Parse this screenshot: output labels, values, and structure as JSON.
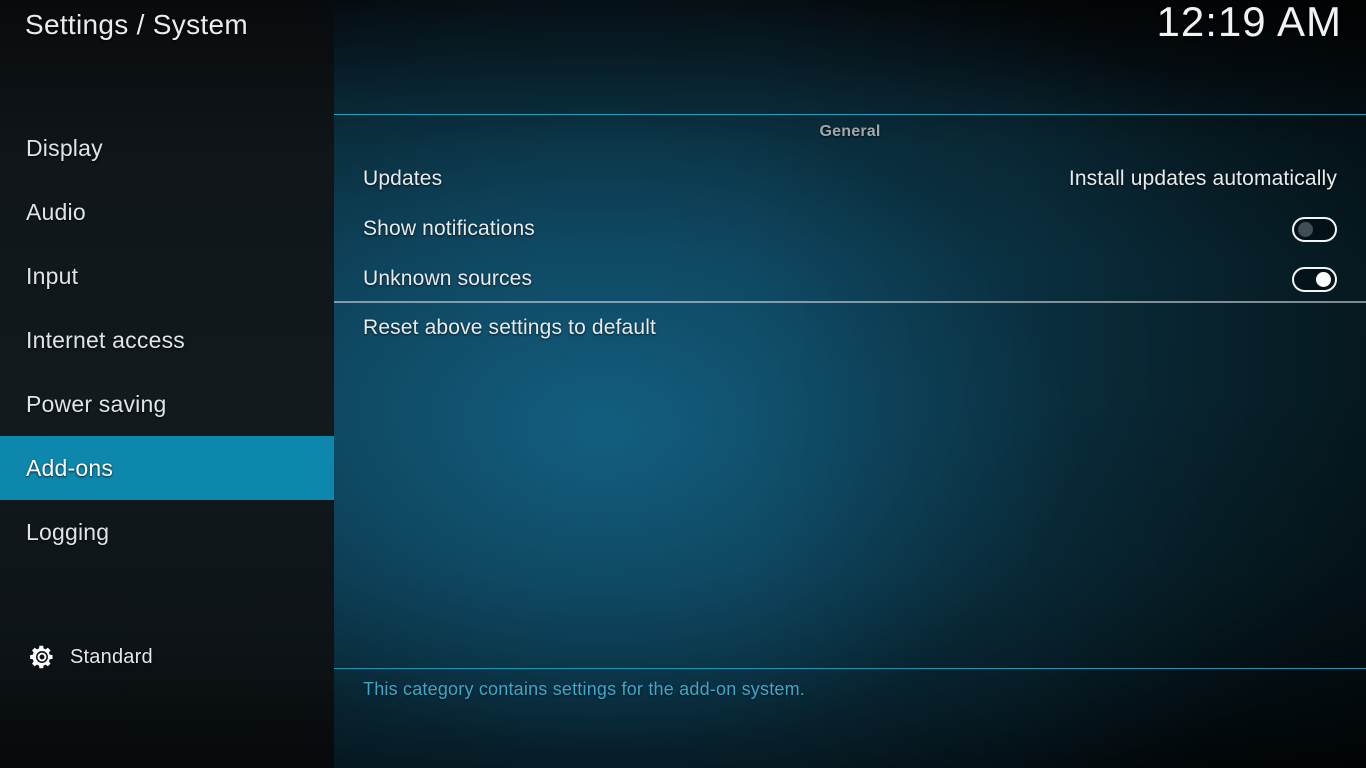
{
  "window": {
    "title": "Settings / System",
    "clock": "12:19 AM"
  },
  "theme": {
    "accent": "#0e87ad",
    "rule_teal": "#1fb6d6",
    "description_color": "#3ea8c8",
    "sidebar_bg": "#10161a",
    "text_primary": "#e7ebec",
    "group_header_color": "#9fa9ad"
  },
  "sidebar": {
    "items": [
      {
        "label": "Display",
        "selected": false,
        "icon": "category-icon"
      },
      {
        "label": "Audio",
        "selected": false,
        "icon": "category-icon"
      },
      {
        "label": "Input",
        "selected": false,
        "icon": "category-icon"
      },
      {
        "label": "Internet access",
        "selected": false,
        "icon": "category-icon"
      },
      {
        "label": "Power saving",
        "selected": false,
        "icon": "category-icon"
      },
      {
        "label": "Add-ons",
        "selected": true,
        "icon": "category-icon"
      },
      {
        "label": "Logging",
        "selected": false,
        "icon": "category-icon"
      }
    ],
    "profile": {
      "icon": "gear-icon",
      "label": "Standard"
    }
  },
  "content": {
    "group_header": "General",
    "settings": [
      {
        "label": "Updates",
        "type": "value",
        "value": "Install updates automatically"
      },
      {
        "label": "Show notifications",
        "type": "toggle",
        "value": "off"
      },
      {
        "label": "Unknown sources",
        "type": "toggle",
        "value": "on"
      }
    ],
    "action": {
      "label": "Reset above settings to default"
    },
    "description": "This category contains settings for the add-on system."
  }
}
